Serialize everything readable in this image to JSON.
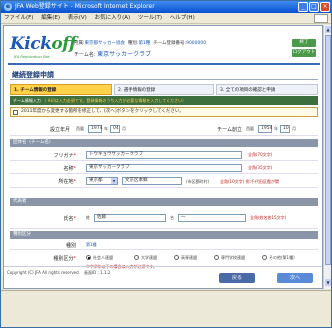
{
  "window": {
    "title": "JFA Web登録サイト - Microsoft Internet Explorer",
    "icon": "e",
    "minimize": "_",
    "maximize": "□",
    "close": "×"
  },
  "menu": [
    "ファイル(F)",
    "編集(E)",
    "表示(V)",
    "お気に入り(A)",
    "ツール(T)",
    "ヘルプ(H)"
  ],
  "header": {
    "logo_main": "Kick",
    "logo_off": "off",
    "logo_sub": "JFA Registration Site",
    "info_label": "所属:",
    "info_value": "東京都サッカー協会",
    "type_label": "種別:",
    "type_value": "第1種",
    "team_no_label": "チーム登録番号:",
    "team_no_value": "9000000",
    "team_label": "チーム名:",
    "team_value": "東京サッカークラブ",
    "btn1": "終了",
    "btn2": "ログアウト"
  },
  "page": {
    "section_title": "継続登録申請",
    "steps": [
      "1. チーム情報の登録",
      "2. 選手情報の登録",
      "3. 全ての項目の確認と申請"
    ],
    "sub_bar_label": "チーム情報入力",
    "sub_bar_text": "（ ※印は入力必須です。登録情報のうち入力が必要な情報を入力してください）",
    "note": "2011年度から変更する箇所を修正して、[次へ]ボタンをクリックしてください。"
  },
  "form": {
    "founded_label": "設立年月",
    "founded_era": "西暦",
    "founded_year": "1974",
    "founded_year_unit": "年",
    "founded_month": "04",
    "founded_month_unit": "月",
    "affiliated_label": "チーム創立",
    "affiliated_era": "西暦",
    "affiliated_year": "1954",
    "affiliated_year_unit": "年",
    "affiliated_month": "10",
    "affiliated_month_unit": "月",
    "group1_title": "団体名（チーム名）",
    "kana_label": "フリガナ",
    "kana_value": "トウキョウサッカークラブ",
    "kana_hint": "全角(70文字)",
    "name_label": "名称",
    "name_value": "東京サッカークラブ",
    "name_hint": "全角(35文字)",
    "address_label": "所在地",
    "pref_value": "東京都",
    "city_value": "文京区本郷",
    "address_hint1": "(市区郡町村)",
    "address_hint2": "全角(10文字) 例:千代田区霞が関",
    "group2_title": "代表者",
    "rep_label": "氏名",
    "rep_sei_label": "姓",
    "rep_sei": "佐藤",
    "rep_mei_label": "名",
    "rep_mei": "一",
    "rep_hint": "全角(姓名各15文字)",
    "group3_title": "種別区分",
    "kind_label": "種別",
    "kind_value": "第1種",
    "kind2_label": "種別区分",
    "kind2_options": [
      "社会人連盟",
      "大学連盟",
      "高専連盟",
      "専門学校連盟",
      "その他(第1種)"
    ],
    "kind2_note": "※中学年以下の場合は入力が必須です。"
  },
  "footer": {
    "back": "戻る",
    "next": "次へ",
    "copyright": "Copyright (C) JFA All rights reserved.",
    "version": "画面ID : 1.1.2"
  }
}
